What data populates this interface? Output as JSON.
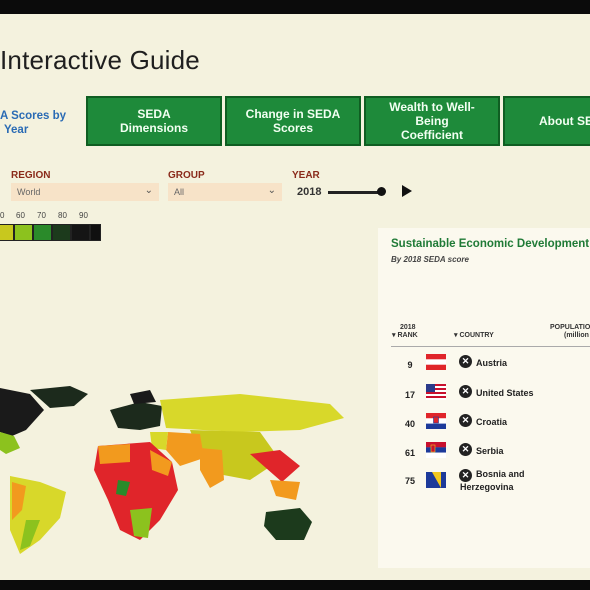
{
  "page": {
    "title": "Interactive Guide"
  },
  "nav": {
    "side_label_line1": "A Scores by",
    "side_label_line2": "Year",
    "tabs": [
      {
        "label_line1": "SEDA",
        "label_line2": "Dimensions"
      },
      {
        "label_line1": "Change in SEDA",
        "label_line2": "Scores"
      },
      {
        "label_line1": "Wealth to Well-",
        "label_line2": "Being",
        "label_line3": "Coefficient"
      },
      {
        "label_line1": "About SE"
      }
    ]
  },
  "filters": {
    "region_label": "REGION",
    "region_value": "World",
    "group_label": "GROUP",
    "group_value": "All",
    "year_label": "YEAR",
    "year_value": "2018",
    "year_position": 1.0
  },
  "legend": {
    "ticks": [
      "0",
      "60",
      "70",
      "80",
      "90"
    ],
    "colors": [
      "#c8c81e",
      "#8cc21e",
      "#2a8a2a",
      "#1c3a1c",
      "#151515",
      "#101010"
    ]
  },
  "ranking": {
    "title": "Sustainable Economic Development",
    "subtitle": "By 2018 SEDA score",
    "col_rank_line1": "2018",
    "col_rank_line2": "RANK",
    "col_country": "COUNTRY",
    "col_population_line1": "POPULATIO",
    "col_population_line2": "(million",
    "rows": [
      {
        "rank": "9",
        "country": "Austria",
        "flag": "austria"
      },
      {
        "rank": "17",
        "country": "United States",
        "flag": "usa"
      },
      {
        "rank": "40",
        "country": "Croatia",
        "flag": "croatia"
      },
      {
        "rank": "61",
        "country": "Serbia",
        "flag": "serbia"
      },
      {
        "rank": "75",
        "country_line1": "Bosnia and",
        "country_line2": "Herzegovina",
        "flag": "bosnia"
      }
    ]
  },
  "colors": {
    "tab_green": "#1e8a3a",
    "title_green": "#1f7a36",
    "accent_blue": "#2a6bb4",
    "low_score_red": "#e03a1e",
    "mid_score_orange": "#f29a1e",
    "high_score_yellow": "#d8d82a"
  }
}
